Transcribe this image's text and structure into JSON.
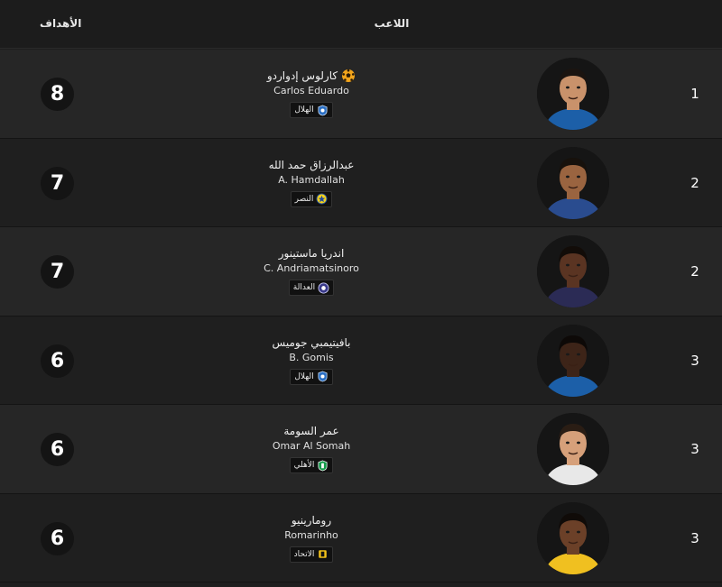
{
  "header": {
    "goals_label": "الأهداف",
    "player_label": "اللاعب"
  },
  "rows": [
    {
      "goals": "8",
      "name_ar": "كارلوس إدواردو",
      "name_en": "Carlos Eduardo",
      "club": "الهلال",
      "club_icon": "alhilal-crest-icon",
      "rank": "1",
      "top_scorer": true,
      "skin": "#c9926b",
      "hair": "#1b1410",
      "shirt": "#1c5fa8"
    },
    {
      "goals": "7",
      "name_ar": "عبدالرزاق حمد الله",
      "name_en": "A. Hamdallah",
      "club": "النصر",
      "club_icon": "alnassr-crest-icon",
      "rank": "2",
      "top_scorer": false,
      "skin": "#9a6440",
      "hair": "#17110c",
      "shirt": "#2a4c8f"
    },
    {
      "goals": "7",
      "name_ar": "اندريا ماستينور",
      "name_en": "C. Andriamatsinoro",
      "club": "العدالة",
      "club_icon": "aladalah-crest-icon",
      "rank": "2",
      "top_scorer": false,
      "skin": "#5a3422",
      "hair": "#120c08",
      "shirt": "#2b2b55"
    },
    {
      "goals": "6",
      "name_ar": "بافيتيمبي جوميس",
      "name_en": "B. Gomis",
      "club": "الهلال",
      "club_icon": "alhilal-crest-icon",
      "rank": "3",
      "top_scorer": false,
      "skin": "#3d2418",
      "hair": "#0d0907",
      "shirt": "#1c5fa8"
    },
    {
      "goals": "6",
      "name_ar": "عمر السومة",
      "name_en": "Omar Al Somah",
      "club": "الأهلي",
      "club_icon": "alahli-crest-icon",
      "rank": "3",
      "top_scorer": false,
      "skin": "#d6a07a",
      "hair": "#2a1d14",
      "shirt": "#e8e8e8"
    },
    {
      "goals": "6",
      "name_ar": "رومارينيو",
      "name_en": "Romarinho",
      "club": "الاتحاد",
      "club_icon": "alittihad-crest-icon",
      "rank": "3",
      "top_scorer": false,
      "skin": "#6b4028",
      "hair": "#100b08",
      "shirt": "#f0c020"
    }
  ],
  "colors": {
    "accent": "#3fa9c9",
    "row_odd": "#262626",
    "row_even": "#1f1f1f",
    "goals_circle": "#141414",
    "ball": "#f2a51c"
  }
}
